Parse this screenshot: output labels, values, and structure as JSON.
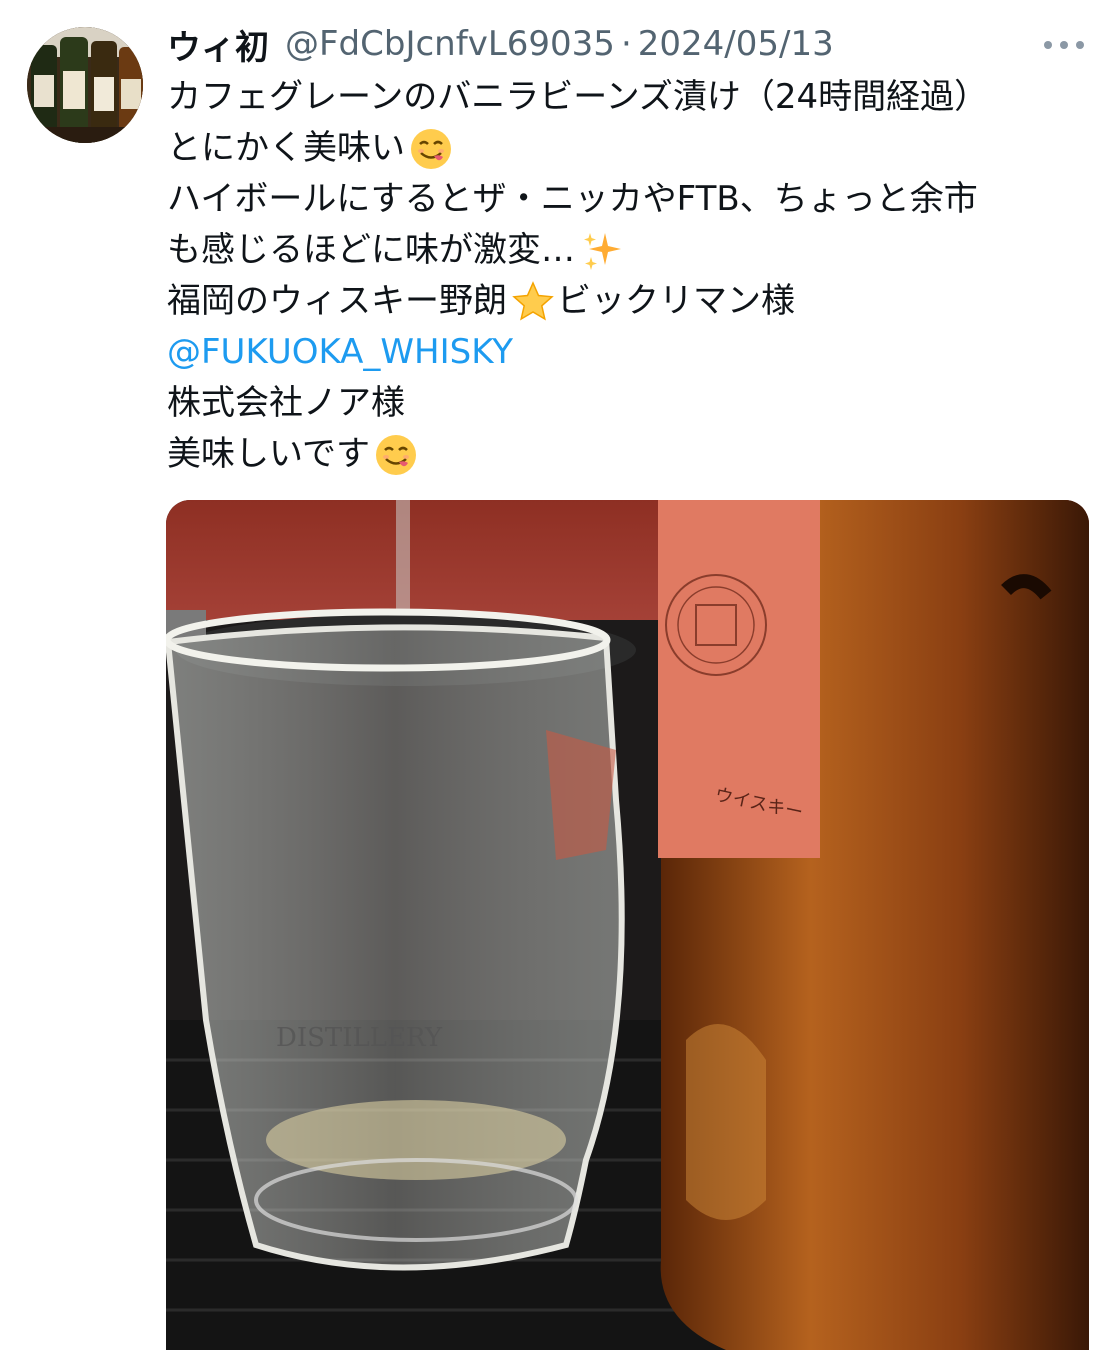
{
  "tweet": {
    "display_name": "ウィ初",
    "handle": "@FdCbJcnfvL69035",
    "separator": "·",
    "date": "2024/05/13",
    "lines": [
      {
        "text": "カフェグレーンのバニラビーンズ漬け（24時間経過）",
        "emoji": ""
      },
      {
        "text": "とにかく美味い",
        "emoji": "yum-face"
      },
      {
        "text": "ハイボールにするとザ・ニッカやFTB、ちょっと余市",
        "emoji": ""
      },
      {
        "text": "も感じるほどに味が激変…",
        "emoji": "sparkles"
      },
      {
        "text": "福岡のウィスキー野朗",
        "emoji": "star",
        "after": "ビックリマン様"
      },
      {
        "text": "@FUKUOKA_WHISKY",
        "emoji": "",
        "mention": true
      },
      {
        "text": "株式会社ノア様",
        "emoji": ""
      },
      {
        "text": "美味しいです",
        "emoji": "yum-face"
      }
    ],
    "photo": {
      "label_text": "ウイスキー",
      "glass_text": "DISTILLERY"
    }
  },
  "colors": {
    "text": "#0f1419",
    "secondary": "#536471",
    "mention": "#1d9bf0",
    "bottle_label": "#e07a62",
    "bottle_liquid": "#8a3f12"
  },
  "icons": {
    "more": "more-dots-icon",
    "avatar": "avatar-whisky-bottles",
    "emoji_yum": "face-savoring-food-icon",
    "emoji_sparkles": "sparkles-icon",
    "emoji_star": "star-icon"
  }
}
